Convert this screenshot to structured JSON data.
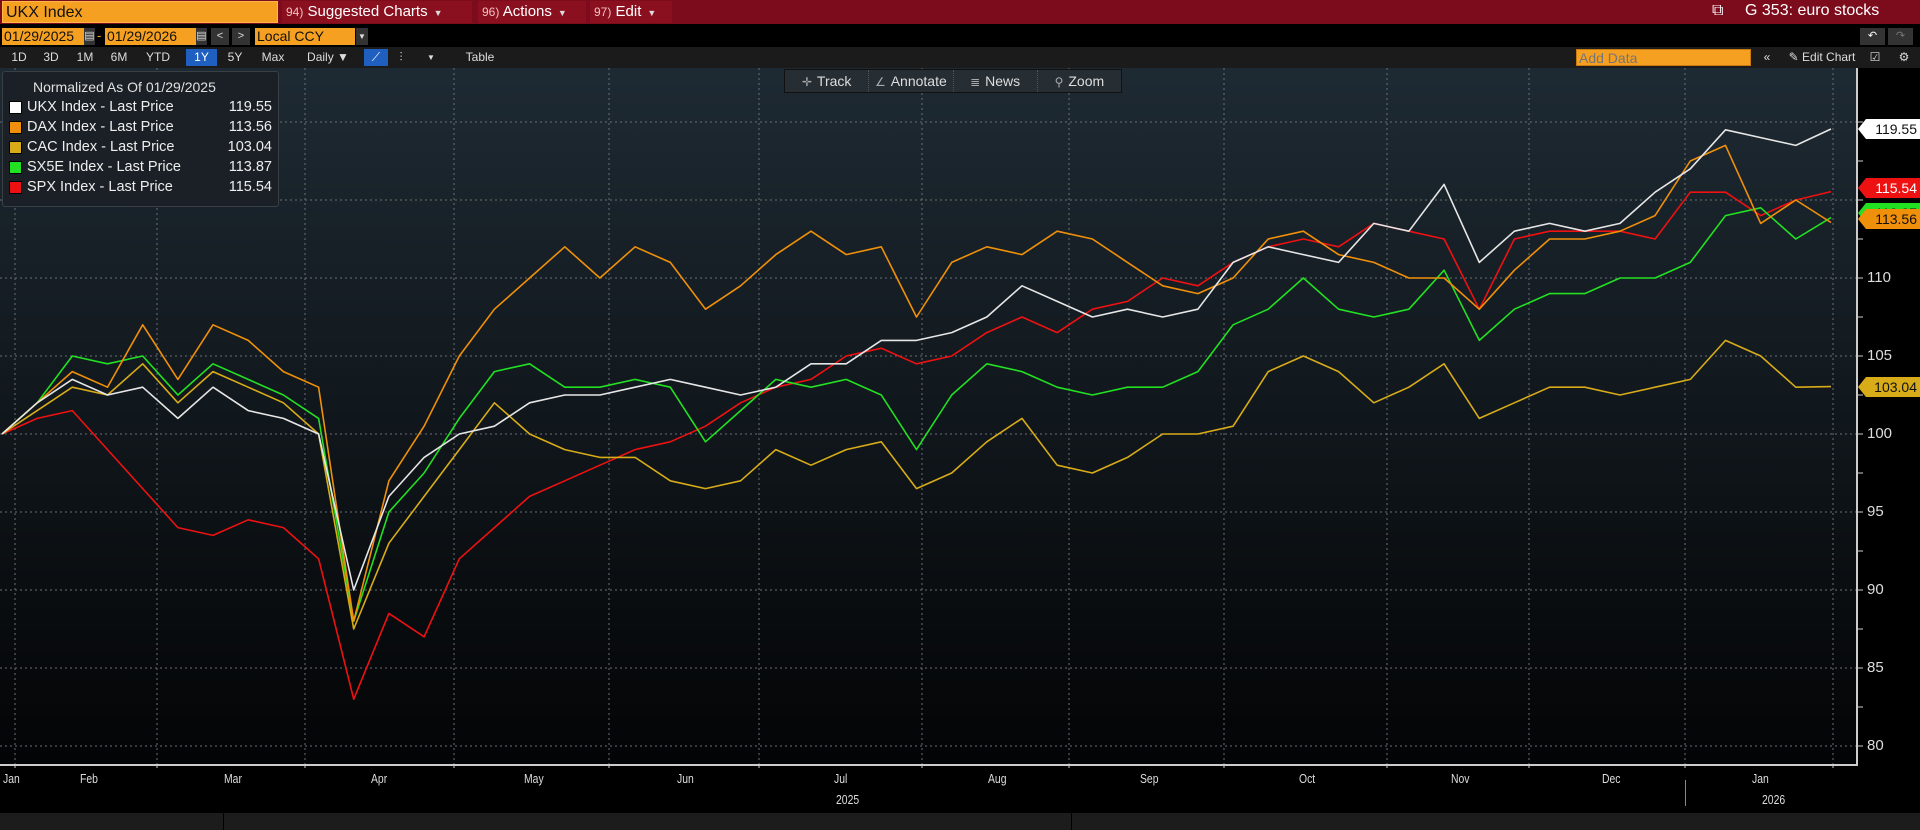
{
  "header": {
    "security": "UKX Index",
    "suggested": {
      "num": "94)",
      "label": "Suggested Charts"
    },
    "actions": {
      "num": "96)",
      "label": "Actions"
    },
    "edit": {
      "num": "97)",
      "label": "Edit"
    },
    "launchpad": "G 353: euro stocks"
  },
  "range": {
    "start": "01/29/2025",
    "end": "01/29/2026",
    "dash": "-",
    "currency": "Local CCY"
  },
  "periods": [
    "1D",
    "3D",
    "1M",
    "6M",
    "YTD",
    "1Y",
    "5Y",
    "Max"
  ],
  "active_period": "1Y",
  "frequency": "Daily ▼",
  "table_label": "Table",
  "toolbar_right": {
    "add_data_placeholder": "Add Data",
    "collapse": "«",
    "edit_chart": "Edit Chart"
  },
  "tools": [
    {
      "icon": "✛",
      "label": "Track"
    },
    {
      "icon": "∠",
      "label": "Annotate"
    },
    {
      "icon": "≣",
      "label": "News"
    },
    {
      "icon": "⚲",
      "label": "Zoom"
    }
  ],
  "legend": {
    "title": "Normalized As Of 01/29/2025"
  },
  "chart_data": {
    "type": "line",
    "title": "Normalized As Of 01/29/2025",
    "xlabel": "",
    "ylabel": "",
    "ylim": [
      80,
      120
    ],
    "y_ticks": [
      80,
      85,
      90,
      95,
      100,
      105,
      110,
      115,
      120
    ],
    "y_tick_labels": [
      "80",
      "85",
      "90",
      "95",
      "100",
      "105",
      "110"
    ],
    "x_start": "2025-01-29",
    "x_end": "2026-01-29",
    "x_step": "weekly",
    "months": [
      "Jan",
      "Feb",
      "Mar",
      "Apr",
      "May",
      "Jun",
      "Jul",
      "Aug",
      "Sep",
      "Oct",
      "Nov",
      "Dec",
      "Jan"
    ],
    "years": [
      "2025",
      "2026"
    ],
    "grid": true,
    "legend_position": "top-left",
    "series": [
      {
        "name": "UKX Index - Last Price",
        "last": "119.55",
        "color": "#ffffff",
        "values": [
          100,
          102,
          103.5,
          102.5,
          103,
          101,
          103,
          101.5,
          101,
          100,
          90,
          96,
          98.5,
          100,
          100.5,
          102,
          102.5,
          102.5,
          103,
          103.5,
          103,
          102.5,
          103,
          104.5,
          104.5,
          106,
          106,
          106.5,
          107.5,
          109.5,
          108.5,
          107.5,
          108,
          107.5,
          108,
          111,
          112,
          111.5,
          111,
          113.5,
          113,
          116,
          111,
          113,
          113.5,
          113,
          113.5,
          115.5,
          117,
          119.5,
          119,
          118.5,
          119.55
        ]
      },
      {
        "name": "DAX Index - Last Price",
        "last": "113.56",
        "color": "#f0900a",
        "values": [
          100,
          102,
          104,
          103,
          107,
          103.5,
          107,
          106,
          104,
          103,
          88,
          97,
          100.5,
          105,
          108,
          110,
          112,
          110,
          112,
          111,
          108,
          109.5,
          111.5,
          113,
          111.5,
          112,
          107.5,
          111,
          112,
          111.5,
          113,
          112.5,
          111,
          109.5,
          109,
          110,
          112.5,
          113,
          111.5,
          111,
          110,
          110,
          108,
          110.5,
          112.5,
          112.5,
          113,
          114,
          117.5,
          118.5,
          113.5,
          115,
          113.56
        ]
      },
      {
        "name": "CAC Index - Last Price",
        "last": "103.04",
        "color": "#d8ac18",
        "values": [
          100,
          101.5,
          103,
          102.5,
          104.5,
          102,
          104,
          103,
          102,
          100,
          87.5,
          93,
          96,
          99,
          102,
          100,
          99,
          98.5,
          98.5,
          97,
          96.5,
          97,
          99,
          98,
          99,
          99.5,
          96.5,
          97.5,
          99.5,
          101,
          98,
          97.5,
          98.5,
          100,
          100,
          100.5,
          104,
          105,
          104,
          102,
          103,
          104.5,
          101,
          102,
          103,
          103,
          102.5,
          103,
          103.5,
          106,
          105,
          103,
          103.04
        ]
      },
      {
        "name": "SX5E Index - Last Price",
        "last": "113.87",
        "color": "#22e022",
        "values": [
          100,
          102,
          105,
          104.5,
          105,
          102.5,
          104.5,
          103.5,
          102.5,
          101,
          88,
          95,
          97.5,
          101,
          104,
          104.5,
          103,
          103,
          103.5,
          103,
          99.5,
          101.5,
          103.5,
          103,
          103.5,
          102.5,
          99,
          102.5,
          104.5,
          104,
          103,
          102.5,
          103,
          103,
          104,
          107,
          108,
          110,
          108,
          107.5,
          108,
          110.5,
          106,
          108,
          109,
          109,
          110,
          110,
          111,
          114,
          114.5,
          112.5,
          113.87
        ]
      },
      {
        "name": "SPX Index - Last Price",
        "last": "115.54",
        "color": "#ee1111",
        "values": [
          100,
          101,
          101.5,
          99,
          96.5,
          94,
          93.5,
          94.5,
          94,
          92,
          83,
          88.5,
          87,
          92,
          94,
          96,
          97,
          98,
          99,
          99.5,
          100.5,
          102,
          103,
          103.5,
          105,
          105.5,
          104.5,
          105,
          106.5,
          107.5,
          106.5,
          108,
          108.5,
          110,
          109.5,
          111,
          112,
          112.5,
          112,
          113.5,
          113,
          112.5,
          108,
          112.5,
          113,
          113,
          113,
          112.5,
          115.5,
          115.5,
          114,
          115,
          115.54
        ]
      }
    ]
  }
}
